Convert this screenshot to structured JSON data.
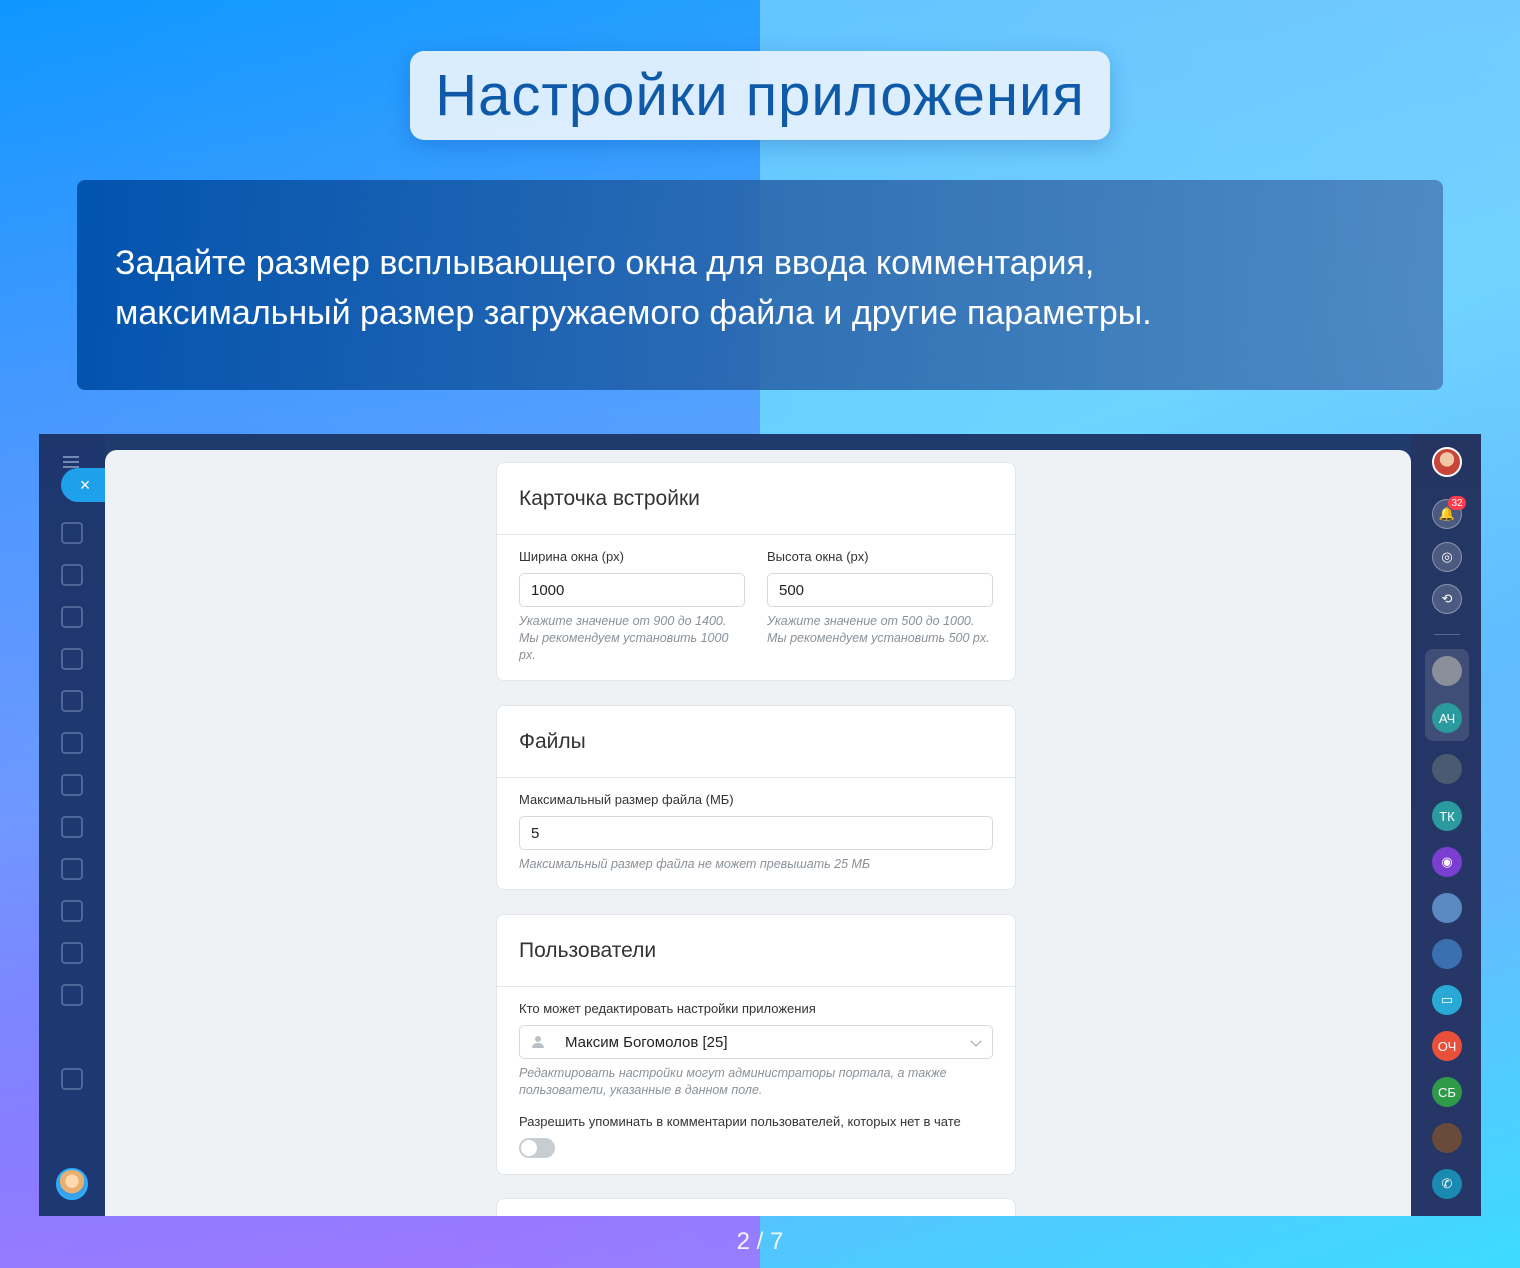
{
  "header": {
    "title": "Настройки приложения",
    "description": "Задайте размер всплывающего окна для ввода комментария, максимальный размер загружаемого файла и другие параметры."
  },
  "pager": "2 / 7",
  "app": {
    "close_label": "×",
    "sections": {
      "embed_card": {
        "title": "Карточка встройки",
        "width_label": "Ширина окна (px)",
        "width_value": "1000",
        "width_hint": "Укажите значение от 900 до 1400. Мы рекомендуем установить 1000 px.",
        "height_label": "Высота окна (px)",
        "height_value": "500",
        "height_hint": "Укажите значение от 500 до 1000. Мы рекомендуем установить 500 px."
      },
      "files": {
        "title": "Файлы",
        "max_size_label": "Максимальный размер файла (МБ)",
        "max_size_value": "5",
        "max_size_hint": "Максимальный размер файла не может превышать 25 МБ"
      },
      "users": {
        "title": "Пользователи",
        "editors_label": "Кто может редактировать настройки приложения",
        "editors_value": "Максим Богомолов [25]",
        "editors_hint": "Редактировать настройки могут администраторы портала, а также пользователи, указанные в данном поле.",
        "mention_label": "Разрешить упоминать в комментарии пользователей, которых нет в чате",
        "mention_enabled": false
      }
    },
    "right_bar": {
      "notifications_count": "32",
      "avatars": [
        "АЧ",
        "ТК",
        "ОЧ",
        "СБ"
      ]
    },
    "colors": {
      "accent": "#1ea0ea",
      "badge": "#ff3b4c"
    }
  }
}
